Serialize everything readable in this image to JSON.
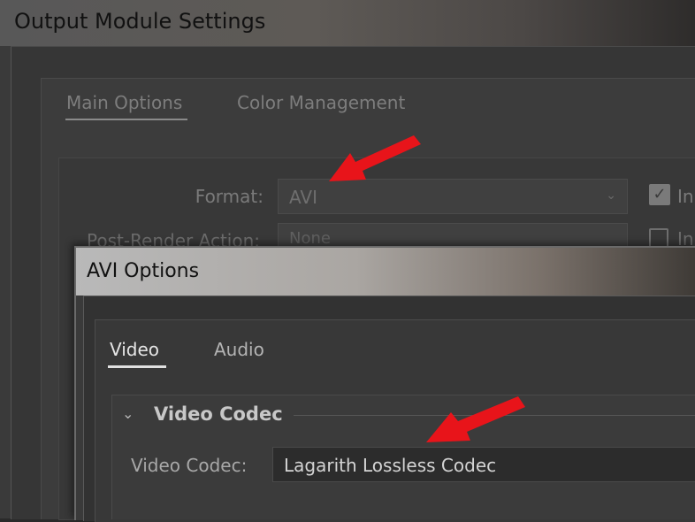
{
  "output_module": {
    "title": "Output Module Settings",
    "tabs": [
      {
        "label": "Main Options",
        "active": true
      },
      {
        "label": "Color Management",
        "active": false
      }
    ],
    "format": {
      "label": "Format:",
      "value": "AVI"
    },
    "post_render": {
      "label": "Post-Render Action:",
      "value": "None"
    },
    "include_checkbox": {
      "label": "In",
      "checked": true
    },
    "second_checkbox": {
      "label": "In",
      "checked": false
    }
  },
  "avi_options": {
    "title": "AVI Options",
    "tabs": [
      {
        "label": "Video",
        "active": true
      },
      {
        "label": "Audio",
        "active": false
      }
    ],
    "section": {
      "title": "Video Codec",
      "expanded": true
    },
    "codec": {
      "label": "Video Codec:",
      "value": "Lagarith Lossless Codec"
    }
  },
  "colors": {
    "annotation_arrow": "#e8141a",
    "dialog_bg": "#3a3a3a",
    "active_text": "#e6e6e6"
  },
  "icons": {
    "select_chevron": "chevron-down-icon",
    "section_chevron": "chevron-down-icon",
    "checkmark": "checkmark-icon"
  }
}
